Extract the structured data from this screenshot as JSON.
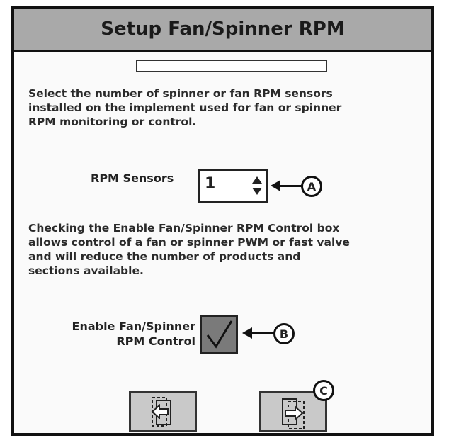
{
  "window": {
    "title": "Setup Fan/Spinner RPM"
  },
  "progress": {
    "value": 0
  },
  "instructions": {
    "sensors": "Select the number of spinner or fan RPM sensors\ninstalled on the implement used for fan or spinner\nRPM monitoring or control.",
    "control": "Checking the Enable Fan/Spinner RPM Control box\nallows control of a fan or spinner PWM or fast valve\nand will reduce the number of products and\nsections available."
  },
  "rpm_sensors": {
    "label": "RPM Sensors",
    "value": "1"
  },
  "enable_control": {
    "label": "Enable Fan/Spinner\nRPM Control",
    "checked": true
  },
  "callouts": {
    "a": "A",
    "b": "B",
    "c": "C"
  },
  "icons": {
    "back": "exit-back-icon",
    "next": "enter-next-icon",
    "spinner": "up-down-arrows-icon",
    "check": "checkmark-icon"
  }
}
